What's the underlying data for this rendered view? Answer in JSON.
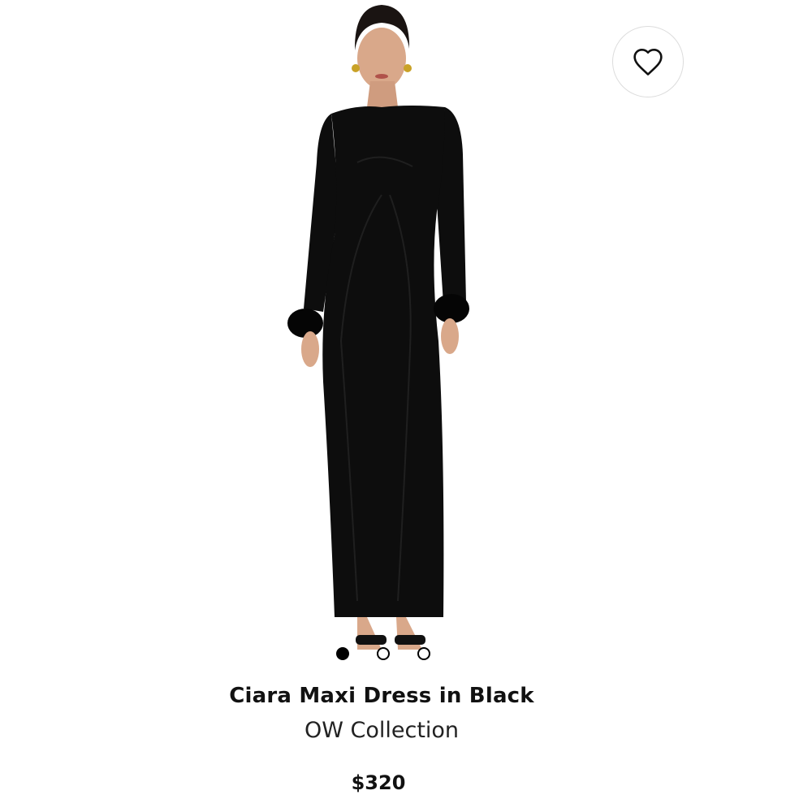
{
  "product": {
    "title": "Ciara Maxi Dress in Black",
    "brand": "OW Collection",
    "price": "$320",
    "image_description": "Model wearing long-sleeve black maxi dress with feather cuffs"
  },
  "wishlist": {
    "icon": "heart-outline-icon"
  },
  "carousel": {
    "total_images": 3,
    "active_index": 0
  },
  "colors": {
    "background": "#ffffff",
    "text": "#111111",
    "dress": "#0d0d0d"
  }
}
